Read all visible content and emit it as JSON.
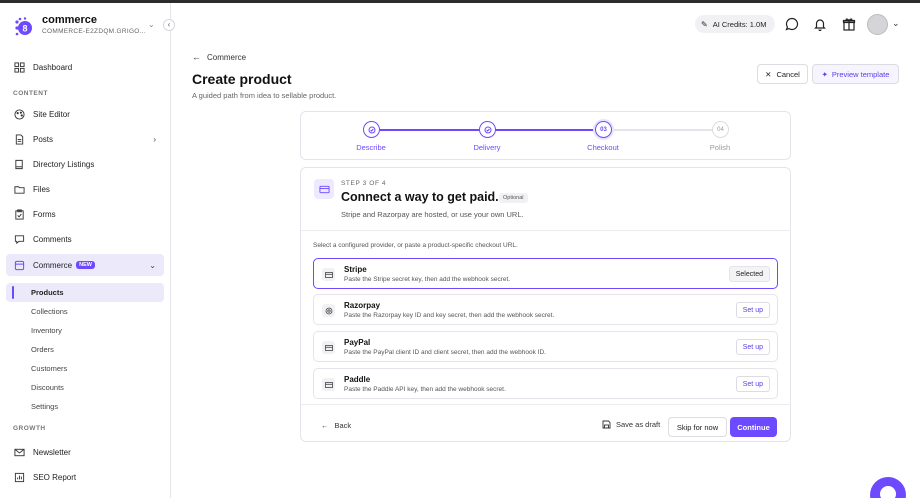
{
  "brand": {
    "name": "commerce",
    "subtitle": "COMMERCE-E2ZDQM.GRIGO...",
    "logo_icon": "dots-logo-icon"
  },
  "sidebar": {
    "dashboard": "Dashboard",
    "section_content": "CONTENT",
    "items": [
      {
        "label": "Site Editor",
        "icon": "palette-icon"
      },
      {
        "label": "Posts",
        "icon": "document-icon"
      },
      {
        "label": "Directory Listings",
        "icon": "book-icon"
      },
      {
        "label": "Files",
        "icon": "folder-icon"
      },
      {
        "label": "Forms",
        "icon": "clipboard-icon"
      },
      {
        "label": "Comments",
        "icon": "comment-icon"
      }
    ],
    "commerce": {
      "label": "Commerce",
      "badge": "NEW"
    },
    "sub_items": [
      "Products",
      "Collections",
      "Inventory",
      "Orders",
      "Customers",
      "Discounts",
      "Settings"
    ],
    "section_growth": "GROWTH",
    "growth_items": [
      {
        "label": "Newsletter",
        "icon": "mail-icon"
      },
      {
        "label": "SEO Report",
        "icon": "chart-icon"
      }
    ]
  },
  "topbar": {
    "ai_credits": "AI Credits: 1.0M"
  },
  "header": {
    "breadcrumb": "Commerce",
    "title": "Create product",
    "subtitle": "A guided path from idea to sellable product.",
    "cancel": "Cancel",
    "preview": "Preview template"
  },
  "stepper": {
    "steps": [
      {
        "label": "Describe",
        "state": "done",
        "marker": ""
      },
      {
        "label": "Delivery",
        "state": "done",
        "marker": ""
      },
      {
        "label": "Checkout",
        "state": "current",
        "marker": "03"
      },
      {
        "label": "Polish",
        "state": "todo",
        "marker": "04"
      }
    ]
  },
  "card": {
    "kicker": "STEP 3 OF 4",
    "title": "Connect a way to get paid.",
    "optional": "Optional",
    "subtitle": "Stripe and Razorpay are hosted, or use your own URL.",
    "instructions": "Select a configured provider, or paste a product-specific checkout URL.",
    "providers": [
      {
        "name": "Stripe",
        "desc": "Paste the Stripe secret key, then add the webhook secret.",
        "action": "Selected",
        "selected": true
      },
      {
        "name": "Razorpay",
        "desc": "Paste the Razorpay key ID and key secret, then add the webhook secret.",
        "action": "Set up",
        "selected": false
      },
      {
        "name": "PayPal",
        "desc": "Paste the PayPal client ID and client secret, then add the webhook ID.",
        "action": "Set up",
        "selected": false
      },
      {
        "name": "Paddle",
        "desc": "Paste the Paddle API key, then add the webhook secret.",
        "action": "Set up",
        "selected": false
      }
    ],
    "back": "Back",
    "save_draft": "Save as draft",
    "skip": "Skip for now",
    "continue": "Continue"
  },
  "colors": {
    "accent": "#6d4aff",
    "accent_light": "#ece9fb"
  }
}
